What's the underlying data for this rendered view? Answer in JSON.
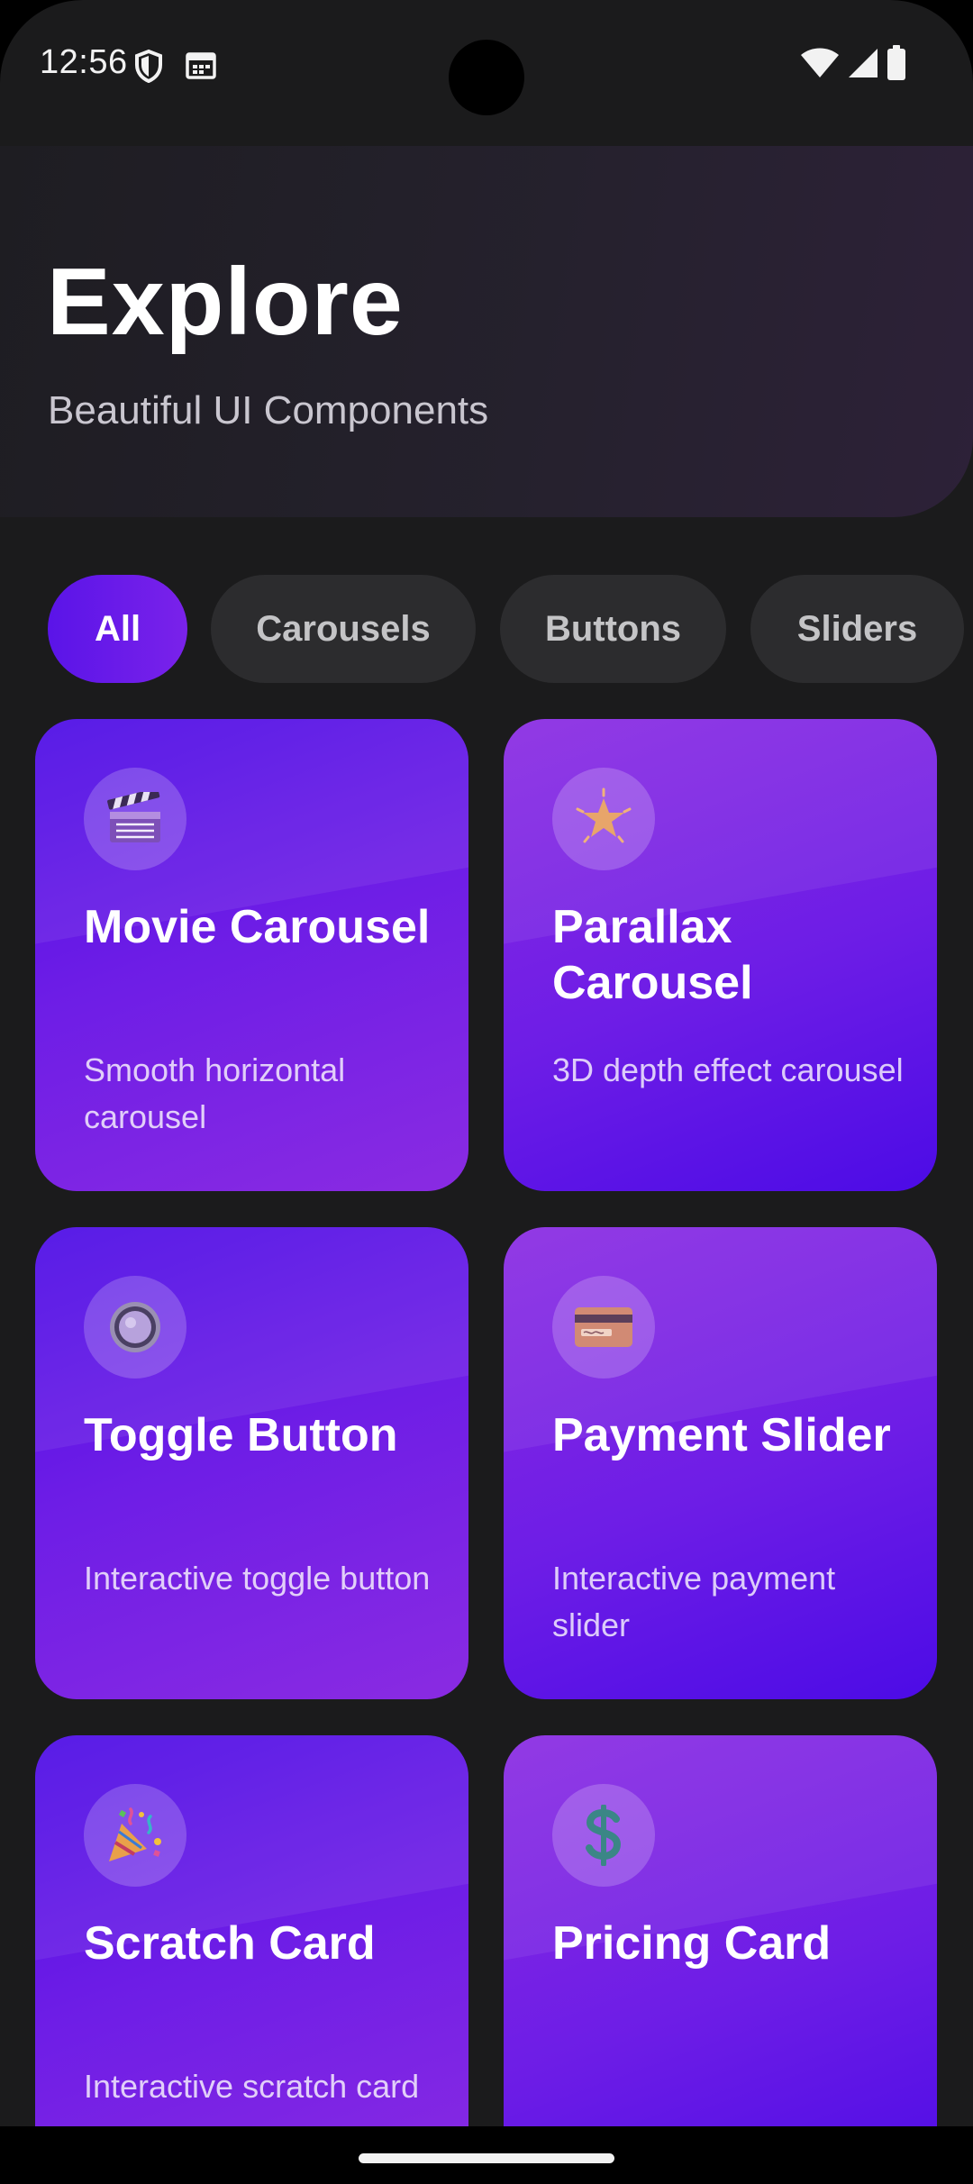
{
  "status_bar": {
    "time": "12:56"
  },
  "header": {
    "title": "Explore",
    "subtitle": "Beautiful UI Components"
  },
  "filters": {
    "chips": [
      {
        "label": "All",
        "active": true
      },
      {
        "label": "Carousels",
        "active": false
      },
      {
        "label": "Buttons",
        "active": false
      },
      {
        "label": "Sliders",
        "active": false
      }
    ]
  },
  "cards": [
    {
      "title": "Movie Carousel",
      "description": "Smooth horizontal carousel",
      "icon": "clapperboard-icon"
    },
    {
      "title": "Parallax Carousel",
      "description": "3D depth effect carousel",
      "icon": "star-icon"
    },
    {
      "title": "Toggle Button",
      "description": "Interactive toggle button",
      "icon": "radio-button-icon"
    },
    {
      "title": "Payment Slider",
      "description": "Interactive payment slider",
      "icon": "credit-card-icon"
    },
    {
      "title": "Scratch Card",
      "description": "Interactive scratch card",
      "icon": "party-popper-icon"
    },
    {
      "title": "Pricing Card",
      "description": "",
      "icon": "dollar-icon"
    }
  ],
  "colors": {
    "background": "#1b1b1c",
    "accent": "#5a14e8",
    "chip_inactive": "#2c2c2e",
    "card_gradient_start": "#4c0be6",
    "card_gradient_end": "#8a2be2"
  }
}
